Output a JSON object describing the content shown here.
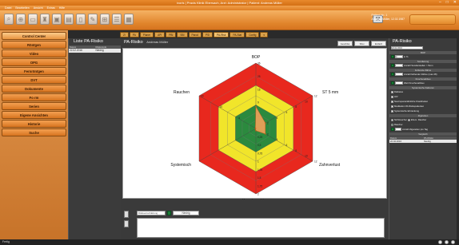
{
  "window": {
    "title": "ivoris | Praxis Klinik Ebersach, Arzt: Administrator | Patient: Andreas Müller",
    "controls": [
      "–",
      "□",
      "✕"
    ]
  },
  "menu": [
    "Datei",
    "Bearbeiten",
    "Ansicht",
    "Extras",
    "Hilfe"
  ],
  "patient": {
    "line1": "Patient-Nr.: 1",
    "line2": "Andreas Müller, 12.02.1987"
  },
  "leftnav": {
    "items": [
      {
        "label": "Control Center"
      },
      {
        "label": "Röntgen"
      },
      {
        "label": "Video"
      },
      {
        "label": "OPG"
      },
      {
        "label": "Fernröntgen"
      },
      {
        "label": "DVT"
      },
      {
        "label": "Dokumente"
      },
      {
        "label": "Fo rm"
      },
      {
        "label": "Serien"
      },
      {
        "label": "Eigene Ansichten"
      },
      {
        "label": "Historie"
      },
      {
        "label": "Suche"
      }
    ]
  },
  "tabs": [
    "ZI",
    "PA",
    "Planer",
    "API",
    "PBI",
    "SBI",
    "Parod",
    "PSI",
    "PA-Risk",
    "PA-Stat",
    "Config",
    "▾"
  ],
  "list": {
    "title": "Liste PA-Risiko",
    "columns": [
      "Datum",
      "Risikostufe"
    ],
    "rows": [
      {
        "date": "22.02.2016",
        "level": "Niedrig"
      }
    ]
  },
  "main": {
    "title": "PA-Risiko",
    "subtitle": "Andreas Müller",
    "view_buttons": [
      "Geschlss",
      "Sfrei",
      "Einfach"
    ],
    "clf_label": "Risikoeinschätzung",
    "clf_value": "Niedrig"
  },
  "chart_data": {
    "type": "radar",
    "axes": [
      "BOP",
      "ST 5 mm",
      "Zahnverlust",
      "Knochenabbau",
      "Systemisch",
      "Rauchen"
    ],
    "tick_labels": {
      "BOP": [
        "4",
        "9",
        "16",
        "25",
        "36"
      ],
      "ST 5 mm": [
        "2",
        "4",
        "6",
        "8",
        "10",
        "12"
      ],
      "Zahnverlust": [
        "2",
        "4",
        "6",
        "8",
        "10",
        "12"
      ],
      "Knochenabbau": [
        "0,25",
        "0,5",
        "0,75",
        "1",
        "1,25",
        "1,5",
        "1,75",
        "2"
      ],
      "Rauchen": [
        "5",
        "10",
        "20"
      ]
    },
    "zones": [
      {
        "name": "niedrig",
        "color": "#2b8a3e"
      },
      {
        "name": "mittel",
        "color": "#f1e52a"
      },
      {
        "name": "hoch",
        "color": "#e8281e"
      }
    ],
    "series": [
      {
        "values": [
          2,
          1,
          1,
          0.2,
          0,
          0
        ],
        "color": "#f3a15a"
      }
    ]
  },
  "rightpanel": {
    "title": "PA-Risiko",
    "date_value": "22.02.2016",
    "sections": [
      {
        "header": "BOP",
        "value": "0",
        "unit": "in %"
      },
      {
        "header": "Sondierung",
        "value": "",
        "unit": "Anzahl Sondierstellen > 5mm"
      },
      {
        "header": "Fehlende Zähne",
        "value": "",
        "unit": "Anzahl fehlender Zähne (max 28)"
      },
      {
        "header": "Knochenabbau",
        "value": "",
        "unit": "Wert Knochenabbau"
      }
    ],
    "systemic": {
      "header": "Systemische Faktoren",
      "items": [
        "Diabetes",
        "HIV",
        "Neutropenie/ähnliche Krankheiten",
        "Medikation IR-Risikopatienten",
        "Systemische Erkrankung"
      ]
    },
    "smoking": {
      "header": "Zigaretten",
      "items": [
        "Nichtraucher",
        "Ehem. Raucher",
        "Raucher"
      ],
      "count_label": "Anzahl Zigaretten pro Tag"
    },
    "history": {
      "header": "Vergleich",
      "columns": [
        "Datum",
        "PA-Risiko"
      ],
      "rows": [
        {
          "date": "22.02.2016",
          "level": "Niedrig"
        }
      ]
    }
  },
  "status": {
    "text": "Fertig"
  }
}
